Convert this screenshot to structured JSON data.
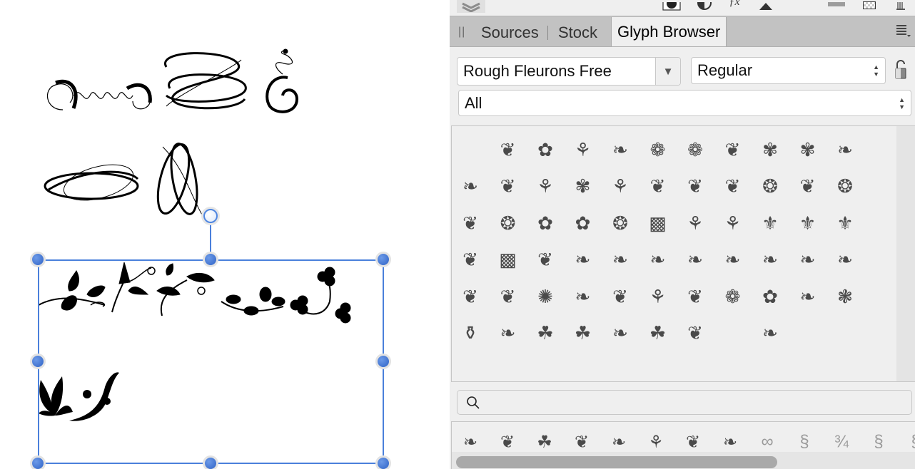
{
  "canvas": {
    "flourishes_top": [
      "flourish-spiral-loops",
      "flourish-interlaced",
      "flourish-c-swirl"
    ],
    "flourishes_middle": [
      "flourish-oval-interlaced",
      "flourish-vertical-interlaced"
    ],
    "selection_glyphs_row1": [
      "vine-leaf-scroll",
      "arrow-leaf-vine",
      "curl-leaf-vine",
      "rose-branch",
      "clover-vine"
    ],
    "selection_glyphs_row2": [
      "tulip-leaf",
      "acanthus-scroll"
    ]
  },
  "panel": {
    "toolbar": {
      "icons": [
        "layers-icon",
        "fill-stroke-icon",
        "contrast-icon",
        "fx-icon",
        "triangle-icon",
        "color-swatch-icon",
        "transparency-icon",
        "trash-icon"
      ]
    },
    "tabs": [
      {
        "label": "Sources",
        "active": false
      },
      {
        "label": "Stock",
        "active": false
      },
      {
        "label": "Glyph Browser",
        "active": true
      }
    ],
    "font_family": "Rough Fleurons Free",
    "font_style": "Regular",
    "category": "All",
    "search": {
      "value": "",
      "placeholder": ""
    },
    "glyph_rows": [
      [
        "",
        "❦",
        "✿",
        "⚘",
        "❧",
        "❁",
        "❁",
        "❦",
        "✾",
        "✾",
        "❧"
      ],
      [
        "❧",
        "❦",
        "⚘",
        "✾",
        "⚘",
        "❦",
        "❦",
        "❦",
        "❂",
        "❦",
        "❂"
      ],
      [
        "❦",
        "❂",
        "✿",
        "✿",
        "❂",
        "▩",
        "⚘",
        "⚘",
        "⚜",
        "⚜",
        "⚜"
      ],
      [
        "❦",
        "▩",
        "❦",
        "❧",
        "❧",
        "❧",
        "❧",
        "❧",
        "❧",
        "❧",
        "❧"
      ],
      [
        "❦",
        "❦",
        "✺",
        "❧",
        "❦",
        "⚘",
        "❦",
        "❁",
        "✿",
        "❧",
        "❃"
      ],
      [
        "⚱",
        "❧",
        "☘",
        "☘",
        "❧",
        "☘",
        "❦",
        "",
        "❧",
        "",
        ""
      ]
    ],
    "recent_glyphs": [
      "❧",
      "❦",
      "☘",
      "❦",
      "❧",
      "⚘",
      "❦",
      "❧",
      "∞",
      "§",
      "¾",
      "§",
      "§"
    ],
    "scroll_position_fraction": 0.0
  }
}
